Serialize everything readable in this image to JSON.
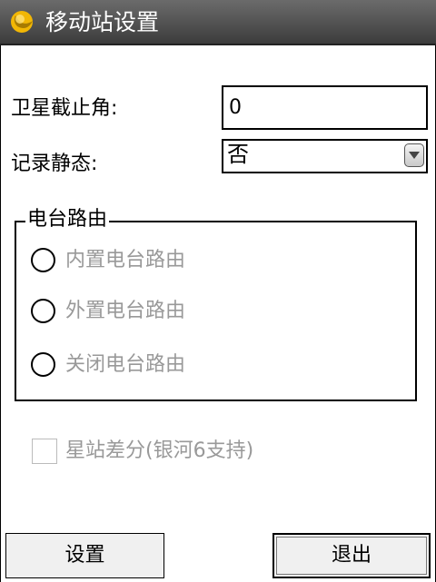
{
  "window": {
    "title": "移动站设置"
  },
  "form": {
    "elevation_label": "卫星截止角:",
    "elevation_value": "0",
    "record_static_label": "记录静态:",
    "record_static_value": "否"
  },
  "radio_group": {
    "legend": "电台路由",
    "options": [
      {
        "label": "内置电台路由",
        "selected": false,
        "enabled": false
      },
      {
        "label": "外置电台路由",
        "selected": false,
        "enabled": false
      },
      {
        "label": "关闭电台路由",
        "selected": false,
        "enabled": false
      }
    ]
  },
  "checkbox": {
    "label": "星站差分(银河6支持)",
    "checked": false,
    "enabled": false
  },
  "buttons": {
    "settings": "设置",
    "exit": "退出"
  },
  "colors": {
    "titlebar": "#4a4a4a",
    "disabled_text": "#999999",
    "icon": "#f2b705"
  }
}
